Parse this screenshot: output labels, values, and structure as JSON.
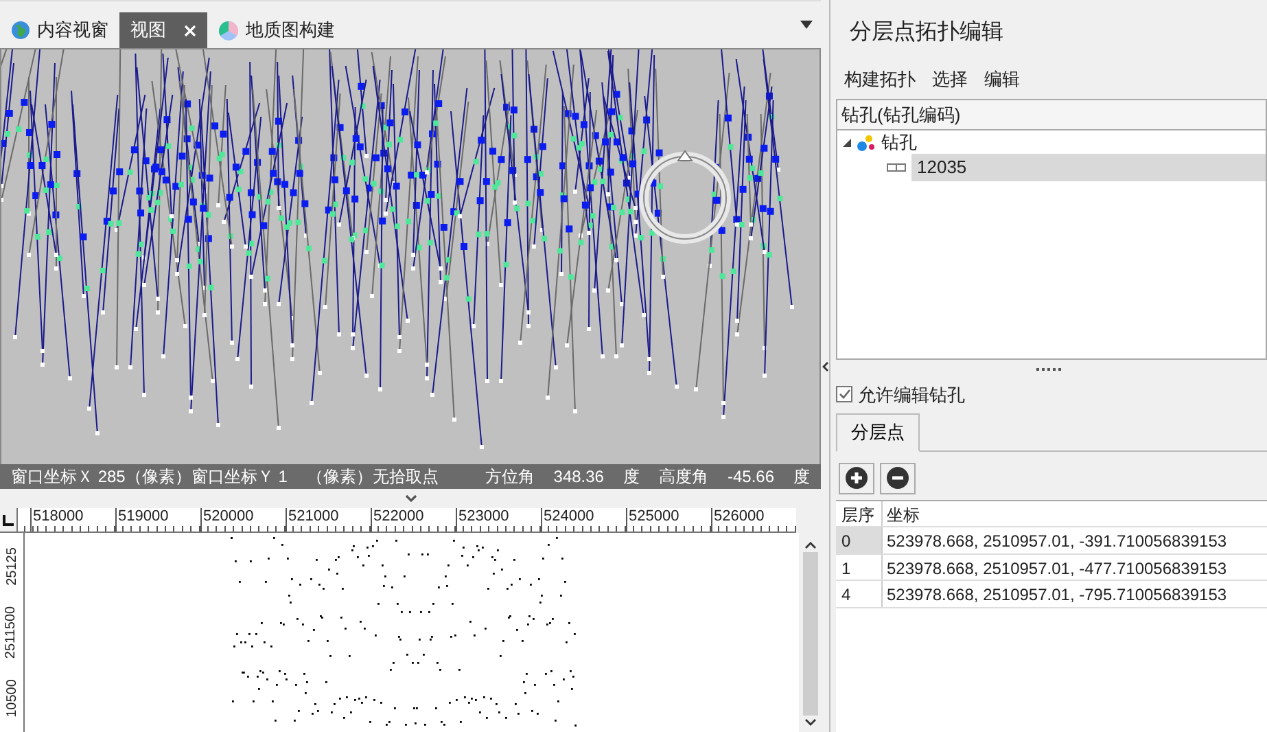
{
  "tabs": [
    {
      "label": "内容视窗",
      "kind": "globe",
      "selected": false,
      "closable": false
    },
    {
      "label": "视图",
      "kind": "none",
      "selected": true,
      "closable": true
    },
    {
      "label": "地质图构建",
      "kind": "cube",
      "selected": false,
      "closable": false
    }
  ],
  "view3d": {
    "status": [
      "窗口坐标Ｘ 285（像素）窗口坐标Ｙ 1",
      "（像素）无拾取点"
    ],
    "azimuth_label": "方位角",
    "azimuth": "348.36",
    "azimuth_unit": "度",
    "elevation_label": "高度角",
    "elevation": "-45.66",
    "elevation_unit": "度"
  },
  "map": {
    "x_ruler": [
      "518000",
      "519000",
      "520000",
      "521000",
      "522000",
      "523000",
      "524000",
      "525000",
      "526000"
    ],
    "y_ruler": [
      "25125",
      "2511500",
      "10500"
    ]
  },
  "panel": {
    "title": "分层点拓扑编辑",
    "menu": [
      "构建拓扑",
      "选择",
      "编辑"
    ],
    "tree_header": "钻孔(钻孔编码)",
    "tree": [
      {
        "label": "钻孔",
        "expanded": true,
        "children": [
          {
            "label": "12035",
            "selected": true
          }
        ]
      }
    ],
    "allow_edit": {
      "label": "允许编辑钻孔",
      "checked": true
    },
    "tabs": [
      {
        "label": "分层点",
        "selected": true
      }
    ],
    "table": {
      "columns": [
        "层序",
        "坐标"
      ],
      "rows": [
        {
          "cells": [
            "0",
            "523978.668, 2510957.01, -391.710056839153"
          ],
          "selected": true
        },
        {
          "cells": [
            "1",
            "523978.668, 2510957.01, -477.710056839153"
          ],
          "selected": false
        },
        {
          "cells": [
            "4",
            "523978.668, 2510957.01, -795.710056839153"
          ],
          "selected": false
        }
      ]
    }
  }
}
